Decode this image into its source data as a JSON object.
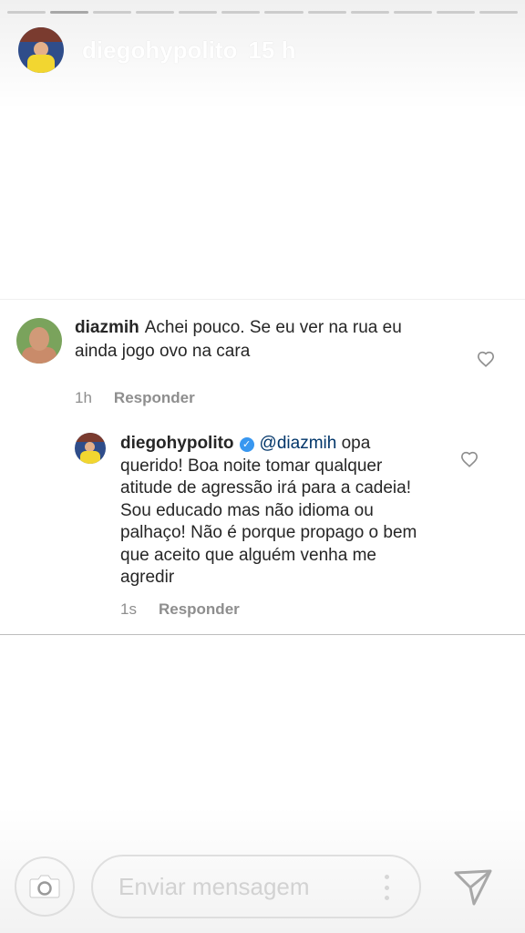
{
  "story": {
    "progress_segments": 12,
    "active_segment": 1,
    "username": "diegohypolito",
    "time": "15 h"
  },
  "comment": {
    "username": "diazmih",
    "text": "Achei pouco. Se eu ver na rua eu ainda jogo ovo na cara",
    "time": "1h",
    "reply_label": "Responder",
    "avatar_icon": "user-avatar"
  },
  "reply": {
    "username": "diegohypolito",
    "verified_icon": "verified-badge-icon",
    "mention": "@diazmih",
    "text": "opa querido! Boa noite tomar qualquer atitude de agressão irá para a cadeia! Sou educado mas não idioma ou palhaço! Não é porque propago o bem que aceito que alguém venha me agredir",
    "time": "1s",
    "reply_label": "Responder"
  },
  "footer": {
    "message_placeholder": "Enviar mensagem",
    "camera_icon": "camera-icon",
    "more_icon": "more-vertical-icon",
    "send_icon": "send-icon"
  },
  "colors": {
    "verified": "#3897f0",
    "mention": "#003569",
    "meta": "#8e8e8e"
  }
}
